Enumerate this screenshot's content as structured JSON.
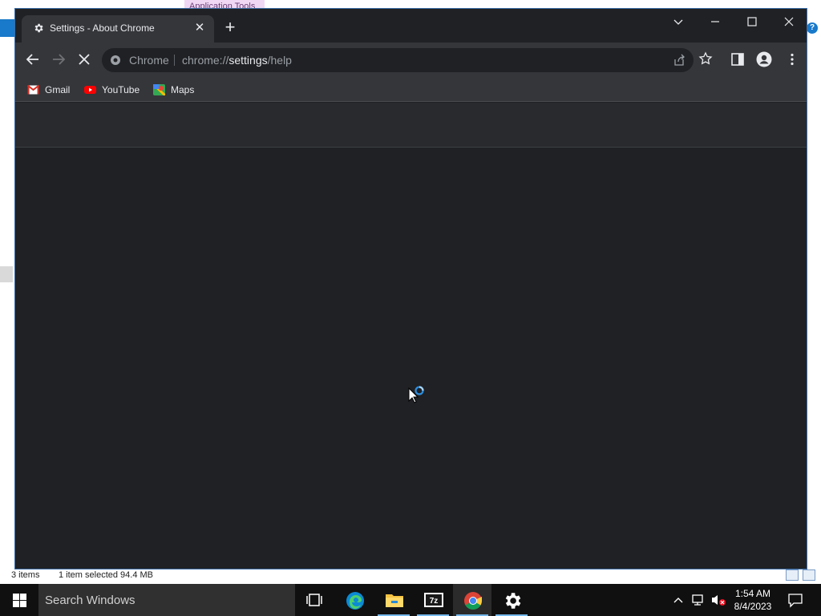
{
  "explorer": {
    "context_tab": "Application Tools",
    "help_glyph": "?",
    "status": {
      "items": "3 items",
      "selected": "1 item selected  94.4 MB"
    }
  },
  "browser": {
    "tab": {
      "title": "Settings - About Chrome",
      "close_glyph": "✕"
    },
    "new_tab_glyph": "+",
    "omnibox": {
      "chip": "Chrome",
      "url_scheme": "chrome://",
      "url_host": "settings",
      "url_path": "/help"
    },
    "bookmarks": [
      {
        "label": "Gmail",
        "icon": "gmail-icon"
      },
      {
        "label": "YouTube",
        "icon": "youtube-icon"
      },
      {
        "label": "Maps",
        "icon": "maps-icon"
      }
    ],
    "loading": true
  },
  "taskbar": {
    "search_placeholder": "Search Windows",
    "apps": [
      "task-view",
      "edge",
      "file-explorer",
      "7-zip",
      "chrome",
      "settings"
    ],
    "active_app": "chrome",
    "clock": {
      "time": "1:54 AM",
      "date": "8/4/2023"
    }
  },
  "colors": {
    "browser_frame": "#202124",
    "toolbar": "#35363a",
    "accent": "#8ab4f8",
    "taskbar": "#101010"
  }
}
